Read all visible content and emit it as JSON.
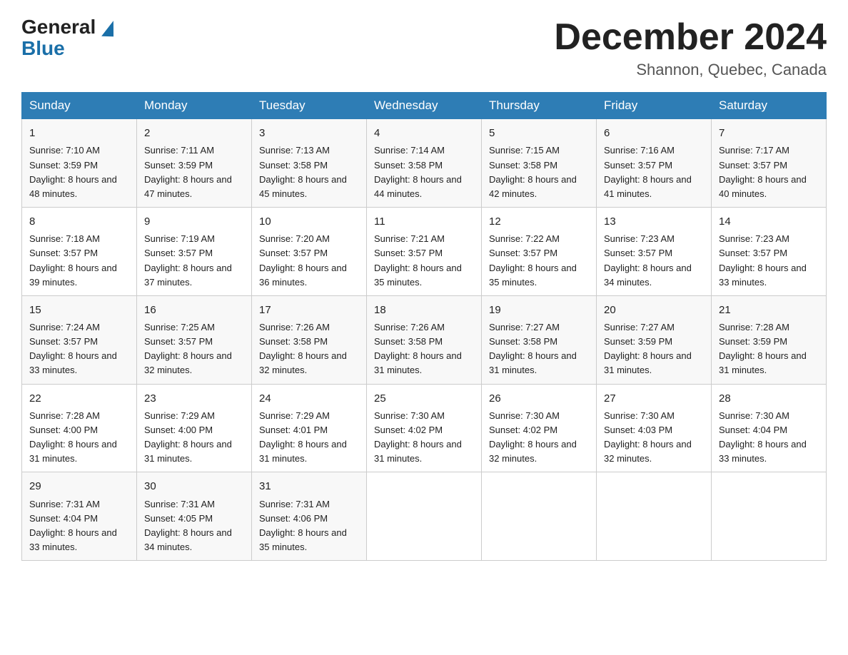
{
  "header": {
    "logo_general": "General",
    "logo_blue": "Blue",
    "month": "December 2024",
    "location": "Shannon, Quebec, Canada"
  },
  "days_of_week": [
    "Sunday",
    "Monday",
    "Tuesday",
    "Wednesday",
    "Thursday",
    "Friday",
    "Saturday"
  ],
  "weeks": [
    [
      {
        "day": 1,
        "sunrise": "7:10 AM",
        "sunset": "3:59 PM",
        "daylight": "8 hours and 48 minutes."
      },
      {
        "day": 2,
        "sunrise": "7:11 AM",
        "sunset": "3:59 PM",
        "daylight": "8 hours and 47 minutes."
      },
      {
        "day": 3,
        "sunrise": "7:13 AM",
        "sunset": "3:58 PM",
        "daylight": "8 hours and 45 minutes."
      },
      {
        "day": 4,
        "sunrise": "7:14 AM",
        "sunset": "3:58 PM",
        "daylight": "8 hours and 44 minutes."
      },
      {
        "day": 5,
        "sunrise": "7:15 AM",
        "sunset": "3:58 PM",
        "daylight": "8 hours and 42 minutes."
      },
      {
        "day": 6,
        "sunrise": "7:16 AM",
        "sunset": "3:57 PM",
        "daylight": "8 hours and 41 minutes."
      },
      {
        "day": 7,
        "sunrise": "7:17 AM",
        "sunset": "3:57 PM",
        "daylight": "8 hours and 40 minutes."
      }
    ],
    [
      {
        "day": 8,
        "sunrise": "7:18 AM",
        "sunset": "3:57 PM",
        "daylight": "8 hours and 39 minutes."
      },
      {
        "day": 9,
        "sunrise": "7:19 AM",
        "sunset": "3:57 PM",
        "daylight": "8 hours and 37 minutes."
      },
      {
        "day": 10,
        "sunrise": "7:20 AM",
        "sunset": "3:57 PM",
        "daylight": "8 hours and 36 minutes."
      },
      {
        "day": 11,
        "sunrise": "7:21 AM",
        "sunset": "3:57 PM",
        "daylight": "8 hours and 35 minutes."
      },
      {
        "day": 12,
        "sunrise": "7:22 AM",
        "sunset": "3:57 PM",
        "daylight": "8 hours and 35 minutes."
      },
      {
        "day": 13,
        "sunrise": "7:23 AM",
        "sunset": "3:57 PM",
        "daylight": "8 hours and 34 minutes."
      },
      {
        "day": 14,
        "sunrise": "7:23 AM",
        "sunset": "3:57 PM",
        "daylight": "8 hours and 33 minutes."
      }
    ],
    [
      {
        "day": 15,
        "sunrise": "7:24 AM",
        "sunset": "3:57 PM",
        "daylight": "8 hours and 33 minutes."
      },
      {
        "day": 16,
        "sunrise": "7:25 AM",
        "sunset": "3:57 PM",
        "daylight": "8 hours and 32 minutes."
      },
      {
        "day": 17,
        "sunrise": "7:26 AM",
        "sunset": "3:58 PM",
        "daylight": "8 hours and 32 minutes."
      },
      {
        "day": 18,
        "sunrise": "7:26 AM",
        "sunset": "3:58 PM",
        "daylight": "8 hours and 31 minutes."
      },
      {
        "day": 19,
        "sunrise": "7:27 AM",
        "sunset": "3:58 PM",
        "daylight": "8 hours and 31 minutes."
      },
      {
        "day": 20,
        "sunrise": "7:27 AM",
        "sunset": "3:59 PM",
        "daylight": "8 hours and 31 minutes."
      },
      {
        "day": 21,
        "sunrise": "7:28 AM",
        "sunset": "3:59 PM",
        "daylight": "8 hours and 31 minutes."
      }
    ],
    [
      {
        "day": 22,
        "sunrise": "7:28 AM",
        "sunset": "4:00 PM",
        "daylight": "8 hours and 31 minutes."
      },
      {
        "day": 23,
        "sunrise": "7:29 AM",
        "sunset": "4:00 PM",
        "daylight": "8 hours and 31 minutes."
      },
      {
        "day": 24,
        "sunrise": "7:29 AM",
        "sunset": "4:01 PM",
        "daylight": "8 hours and 31 minutes."
      },
      {
        "day": 25,
        "sunrise": "7:30 AM",
        "sunset": "4:02 PM",
        "daylight": "8 hours and 31 minutes."
      },
      {
        "day": 26,
        "sunrise": "7:30 AM",
        "sunset": "4:02 PM",
        "daylight": "8 hours and 32 minutes."
      },
      {
        "day": 27,
        "sunrise": "7:30 AM",
        "sunset": "4:03 PM",
        "daylight": "8 hours and 32 minutes."
      },
      {
        "day": 28,
        "sunrise": "7:30 AM",
        "sunset": "4:04 PM",
        "daylight": "8 hours and 33 minutes."
      }
    ],
    [
      {
        "day": 29,
        "sunrise": "7:31 AM",
        "sunset": "4:04 PM",
        "daylight": "8 hours and 33 minutes."
      },
      {
        "day": 30,
        "sunrise": "7:31 AM",
        "sunset": "4:05 PM",
        "daylight": "8 hours and 34 minutes."
      },
      {
        "day": 31,
        "sunrise": "7:31 AM",
        "sunset": "4:06 PM",
        "daylight": "8 hours and 35 minutes."
      },
      null,
      null,
      null,
      null
    ]
  ]
}
